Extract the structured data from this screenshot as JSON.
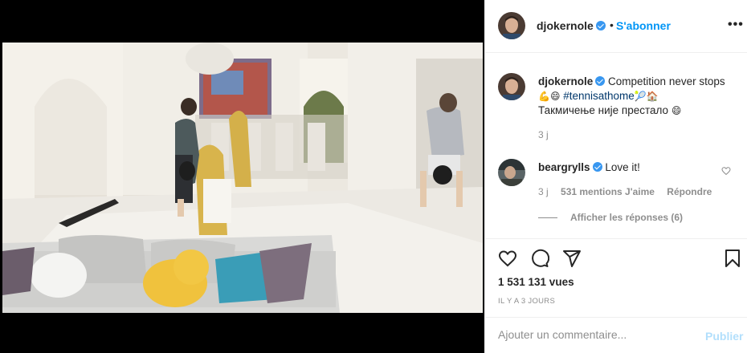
{
  "post": {
    "username": "djokernole",
    "follow_label": "S'abonner",
    "separator": "•",
    "more_label": "•••"
  },
  "caption": {
    "username": "djokernole",
    "text_part1": "Competition never stops",
    "emoji1": "💪😄",
    "hashtag": "#tennisathome",
    "emoji2": "🎾🏠",
    "line2": "Такмичење није престало",
    "emoji3": "😄",
    "time": "3 j"
  },
  "comment": {
    "username": "beargrylls",
    "text": "Love it!",
    "time": "3 j",
    "likes": "531 mentions J'aime",
    "reply_label": "Répondre",
    "view_replies": "Afficher les réponses (6)"
  },
  "stats": {
    "views": "1 531 131 vues",
    "posted_ago": "IL Y A 3 JOURS"
  },
  "add_comment": {
    "placeholder": "Ajouter un commentaire...",
    "post_label": "Publier"
  },
  "icons": [
    "user-tag-icon",
    "more-icon",
    "heart-icon",
    "comment-icon",
    "share-icon",
    "bookmark-icon",
    "verified-icon"
  ],
  "colors": {
    "accent": "#0095f6",
    "verified": "#3897f0",
    "muted": "#8e8e8e",
    "post_disabled": "#b2dffc",
    "hashtag": "#00376b"
  }
}
